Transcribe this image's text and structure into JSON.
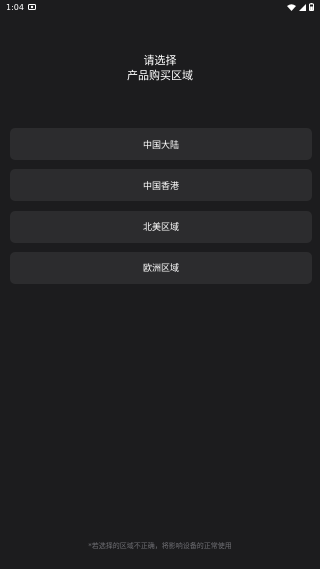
{
  "status_bar": {
    "time": "1:04"
  },
  "header": {
    "line1": "请选择",
    "line2": "产品购买区域"
  },
  "regions": [
    {
      "label": "中国大陆"
    },
    {
      "label": "中国香港"
    },
    {
      "label": "北美区域"
    },
    {
      "label": "欧洲区域"
    }
  ],
  "footer": {
    "note": "*若选择的区域不正确，将影响设备的正常使用"
  },
  "colors": {
    "background": "#1c1c1e",
    "button": "#2c2c2e",
    "footer_text": "#6e6e73"
  }
}
